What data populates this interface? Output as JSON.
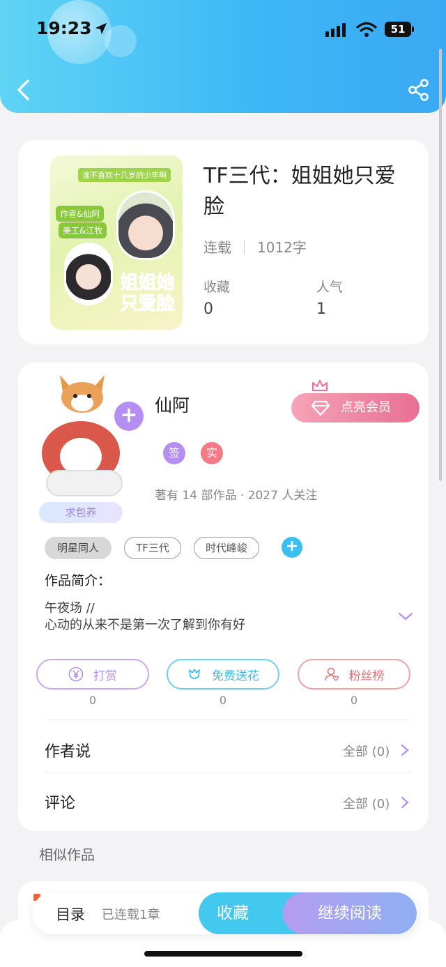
{
  "status_bar": {
    "time": "19:23",
    "battery": "51"
  },
  "header": {
    "back_icon": "chevron-left-icon",
    "share_icon": "share-icon"
  },
  "book": {
    "cover_tagline": "谁不喜欢十几岁的少年啊",
    "cover_tag_author": "作者&仙阿",
    "cover_tag_art": "美工&江牧",
    "cover_title": "姐姐她只爱脸",
    "title": "TF三代：姐姐她只爱脸",
    "status": "连载",
    "word_count": "1012字",
    "stats": [
      {
        "label": "收藏",
        "value": "0"
      },
      {
        "label": "人气",
        "value": "1"
      }
    ]
  },
  "author": {
    "name": "仙阿",
    "avatar_badge": "求包养",
    "vip_label": "点亮会员",
    "badges": [
      "签",
      "实"
    ],
    "stats": "著有 14 部作品 · 2027 人关注",
    "tags": [
      "明星同人",
      "TF三代",
      "时代峰峻"
    ],
    "intro_label": "作品简介：",
    "intro_lines": [
      "午夜场 //",
      "心动的从来不是第一次了解到你有好"
    ]
  },
  "actions": [
    {
      "label": "打赏",
      "icon": "yen-icon",
      "count": "0"
    },
    {
      "label": "免费送花",
      "icon": "flower-icon",
      "count": "0"
    },
    {
      "label": "粉丝榜",
      "icon": "fan-user-icon",
      "count": "0"
    }
  ],
  "rows": [
    {
      "title": "作者说",
      "right": "全部 (0)"
    },
    {
      "title": "评论",
      "right": "全部 (0)"
    }
  ],
  "similar_title": "相似作品",
  "bottom_bar": {
    "catalog": "目录",
    "status": "已连载1章",
    "collect": "收藏",
    "read": "继续阅读"
  },
  "colors": {
    "header_start": "#5fd4f5",
    "header_end": "#3aa9f3",
    "purple": "#b48ef0",
    "cyan": "#39b7e3",
    "pink": "#ea6f78",
    "vip_pink": "#e86f93"
  }
}
